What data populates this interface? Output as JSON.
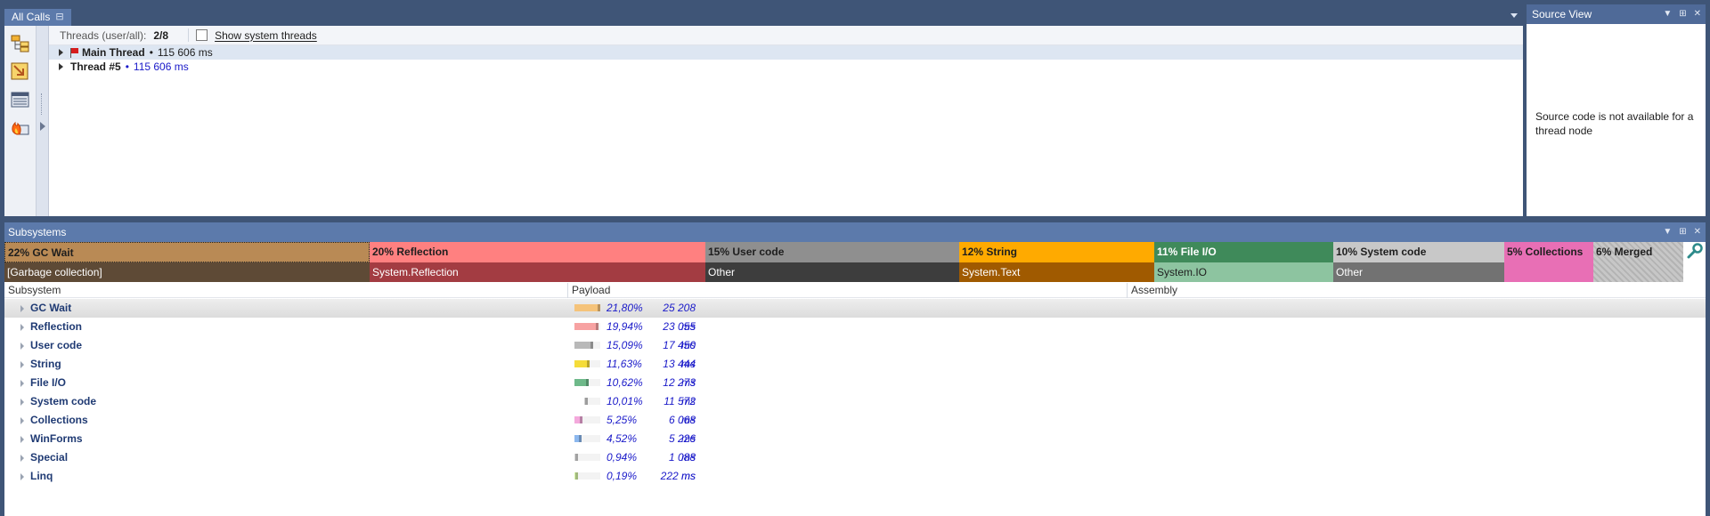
{
  "all_calls": {
    "tab_label": "All Calls",
    "threads_label": "Threads (user/all):",
    "threads_count": "2/8",
    "show_system_threads": "Show system threads",
    "threads": [
      {
        "name": "Main Thread",
        "bullet": "•",
        "time": "115 606 ms",
        "flag": true,
        "selected": true
      },
      {
        "name": "Thread #5",
        "bullet": "•",
        "time": "115 606 ms",
        "flag": false,
        "selected": false
      }
    ]
  },
  "source_view": {
    "title": "Source View",
    "message": "Source code is not available for a thread node"
  },
  "subsystems": {
    "title": "Subsystems",
    "bars": [
      {
        "label": "22% GC Wait",
        "sub": "[Garbage collection]",
        "color": "#b98a55",
        "sub_color": "#5e4a36",
        "text": "#1e1e1e",
        "sub_text": "#ffffff"
      },
      {
        "label": "20% Reflection",
        "sub": "System.Reflection",
        "color": "#ff8080",
        "sub_color": "#a33c42",
        "text": "#1e1e1e",
        "sub_text": "#ffffff"
      },
      {
        "label": "15% User code",
        "sub": "Other",
        "color": "#8f8f8f",
        "sub_color": "#3d3d3d",
        "text": "#1e1e1e",
        "sub_text": "#ffffff"
      },
      {
        "label": "12% String",
        "sub": "System.Text",
        "color": "#ffaa00",
        "sub_color": "#a05a00",
        "text": "#1e1e1e",
        "sub_text": "#ffffff"
      },
      {
        "label": "11% File I/O",
        "sub": "System.IO",
        "color": "#3f8a5a",
        "sub_color": "#8dc4a0",
        "text": "#ffffff",
        "sub_text": "#1e1e1e"
      },
      {
        "label": "10% System code",
        "sub": "Other",
        "color": "#c8c8c8",
        "sub_color": "#727272",
        "text": "#1e1e1e",
        "sub_text": "#ffffff"
      },
      {
        "label": "5% Collections",
        "sub": "",
        "color": "#e86fb5",
        "sub_color": "#e86fb5",
        "text": "#1e1e1e",
        "sub_text": "#1e1e1e"
      },
      {
        "label": "6% Merged",
        "sub": "",
        "color": "#c7c7c7",
        "sub_color": "#c7c7c7",
        "text": "#1e1e1e",
        "sub_text": "#1e1e1e"
      }
    ],
    "columns": [
      "Subsystem",
      "Payload",
      "Assembly"
    ],
    "rows": [
      {
        "name": "GC Wait",
        "percent": "21,80%",
        "ms": "25 208 ms",
        "share": 0.218,
        "color": "#f5c37a"
      },
      {
        "name": "Reflection",
        "percent": "19,94%",
        "ms": "23 055 ms",
        "share": 0.1994,
        "color": "#f7a2a2"
      },
      {
        "name": "User code",
        "percent": "15,09%",
        "ms": "17 450 ms",
        "share": 0.1509,
        "color": "#b9b9b9"
      },
      {
        "name": "String",
        "percent": "11,63%",
        "ms": "13 444 ms",
        "share": 0.1163,
        "color": "#f5dc3a"
      },
      {
        "name": "File I/O",
        "percent": "10,62%",
        "ms": "12 273 ms",
        "share": 0.1062,
        "color": "#6eb98a"
      },
      {
        "name": "System code",
        "percent": "10,01%",
        "ms": "11 572 ms",
        "share": 0.1001,
        "color": "#ffffff"
      },
      {
        "name": "Collections",
        "percent": "5,25%",
        "ms": "6 068 ms",
        "share": 0.0525,
        "color": "#f4a9dc"
      },
      {
        "name": "WinForms",
        "percent": "4,52%",
        "ms": "5 226 ms",
        "share": 0.0452,
        "color": "#8cb8ee"
      },
      {
        "name": "Special",
        "percent": "0,94%",
        "ms": "1 088 ms",
        "share": 0.0094,
        "color": "#d8d8d8"
      },
      {
        "name": "Linq",
        "percent": "0,19%",
        "ms": "222 ms",
        "share": 0.0019,
        "color": "#d6f5a8"
      }
    ]
  }
}
